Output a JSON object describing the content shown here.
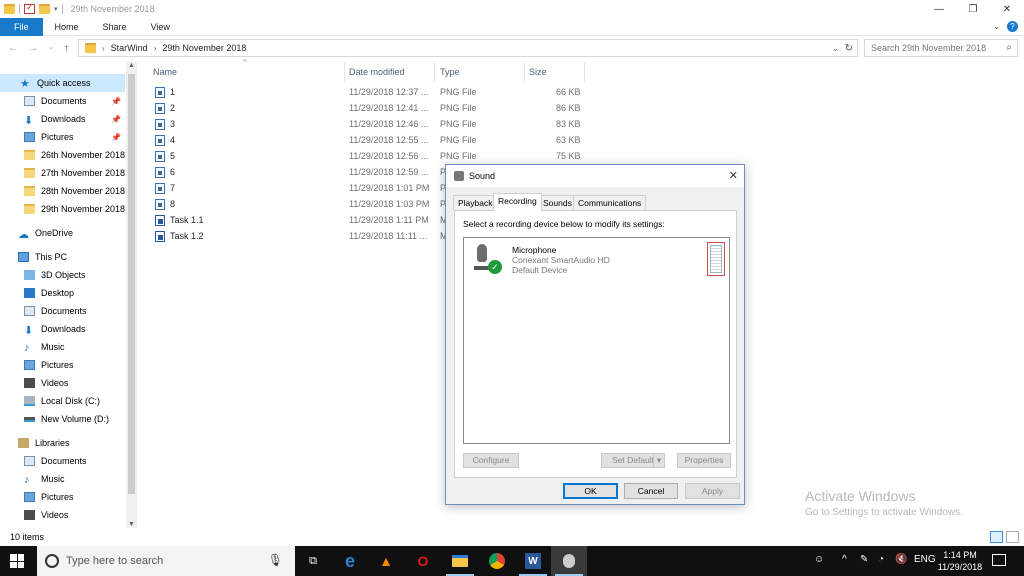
{
  "window": {
    "title": "29th November 2018",
    "controls": [
      "—",
      "❐",
      "✕"
    ]
  },
  "ribbon": {
    "tabs": [
      "File",
      "Home",
      "Share",
      "View"
    ]
  },
  "address": {
    "crumbs": [
      "StarWind",
      "29th November 2018"
    ],
    "search_placeholder": "Search 29th November 2018"
  },
  "sidebar": {
    "items": [
      {
        "label": "Quick access",
        "icon": "star-icon",
        "selected": true
      },
      {
        "label": "Documents",
        "icon": "documents-icon",
        "pinned": true
      },
      {
        "label": "Downloads",
        "icon": "download-icon",
        "pinned": true
      },
      {
        "label": "Pictures",
        "icon": "pictures-icon",
        "pinned": true
      },
      {
        "label": "26th November 2018",
        "icon": "folder-icon"
      },
      {
        "label": "27th November 2018",
        "icon": "folder-icon"
      },
      {
        "label": "28th November 2018",
        "icon": "folder-icon"
      },
      {
        "label": "29th November 2018",
        "icon": "folder-icon"
      },
      {
        "label": "OneDrive",
        "icon": "cloud-icon"
      },
      {
        "label": "This PC",
        "icon": "computer-icon"
      },
      {
        "label": "3D Objects",
        "icon": "3d-objects-icon"
      },
      {
        "label": "Desktop",
        "icon": "desktop-icon"
      },
      {
        "label": "Documents",
        "icon": "documents-icon"
      },
      {
        "label": "Downloads",
        "icon": "download-icon"
      },
      {
        "label": "Music",
        "icon": "music-icon"
      },
      {
        "label": "Pictures",
        "icon": "pictures-icon"
      },
      {
        "label": "Videos",
        "icon": "videos-icon"
      },
      {
        "label": "Local Disk (C:)",
        "icon": "disk-icon"
      },
      {
        "label": "New Volume (D:)",
        "icon": "drive-icon"
      },
      {
        "label": "Libraries",
        "icon": "libraries-icon"
      },
      {
        "label": "Documents",
        "icon": "documents-icon"
      },
      {
        "label": "Music",
        "icon": "music-icon"
      },
      {
        "label": "Pictures",
        "icon": "pictures-icon"
      },
      {
        "label": "Videos",
        "icon": "videos-icon"
      }
    ]
  },
  "filelist": {
    "columns": [
      "Name",
      "Date modified",
      "Type",
      "Size"
    ],
    "rows": [
      {
        "name": "1",
        "date": "11/29/2018 12:37 ...",
        "type": "PNG File",
        "size": "66 KB"
      },
      {
        "name": "2",
        "date": "11/29/2018 12:41 ...",
        "type": "PNG File",
        "size": "86 KB"
      },
      {
        "name": "3",
        "date": "11/29/2018 12:46 ...",
        "type": "PNG File",
        "size": "83 KB"
      },
      {
        "name": "4",
        "date": "11/29/2018 12:55 ...",
        "type": "PNG File",
        "size": "63 KB"
      },
      {
        "name": "5",
        "date": "11/29/2018 12:56 ...",
        "type": "PNG File",
        "size": "75 KB"
      },
      {
        "name": "6",
        "date": "11/29/2018 12:59 ...",
        "type": "PNG File",
        "size": ""
      },
      {
        "name": "7",
        "date": "11/29/2018 1:01 PM",
        "type": "PNG File",
        "size": ""
      },
      {
        "name": "8",
        "date": "11/29/2018 1:03 PM",
        "type": "PNG File",
        "size": ""
      },
      {
        "name": "Task 1.1",
        "date": "11/29/2018 1:11 PM",
        "type": "M",
        "size": ""
      },
      {
        "name": "Task 1.2",
        "date": "11/29/2018 11:11 ...",
        "type": "M",
        "size": ""
      }
    ]
  },
  "sound_dialog": {
    "title": "Sound",
    "tabs": [
      "Playback",
      "Recording",
      "Sounds",
      "Communications"
    ],
    "instruction": "Select a recording device below to modify its settings:",
    "device": {
      "name": "Microphone",
      "driver": "Conexant SmartAudio HD",
      "status": "Default Device"
    },
    "buttons": {
      "configure": "Configure",
      "set_default": "Set Default",
      "properties": "Properties",
      "ok": "OK",
      "cancel": "Cancel",
      "apply": "Apply"
    }
  },
  "watermark": {
    "line1": "Activate Windows",
    "line2": "Go to Settings to activate Windows."
  },
  "status": {
    "count": "10 items"
  },
  "taskbar": {
    "search_placeholder": "Type here to search",
    "lang": "ENG",
    "time": "1:14 PM",
    "date": "11/29/2018"
  }
}
